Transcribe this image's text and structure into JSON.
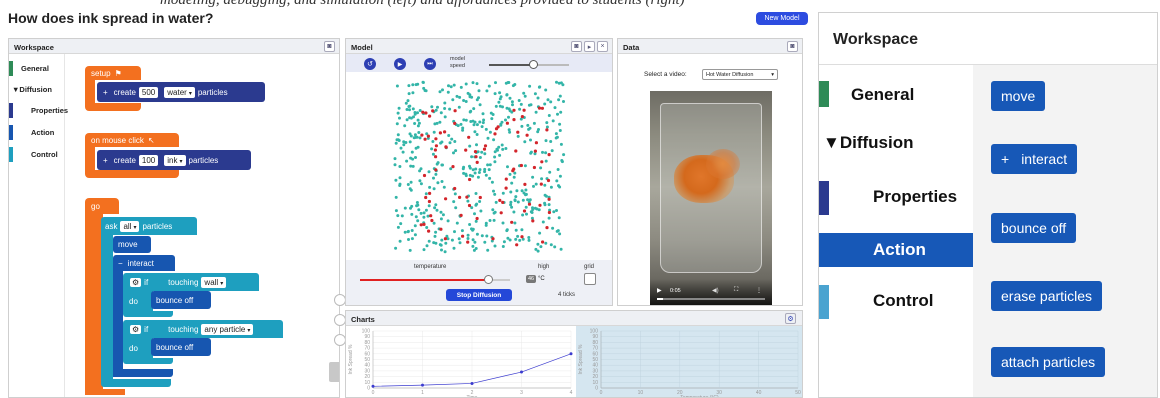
{
  "top_caption": "modeling, debugging, and simulation (left) and affordances provided to students (right)",
  "page_title": "How does ink spread in water?",
  "new_model_label": "New Model",
  "workspace": {
    "title": "Workspace",
    "categories": [
      "General",
      "▼Diffusion",
      "Properties",
      "Action",
      "Control"
    ],
    "blocks": {
      "setup": "setup",
      "create1": {
        "word": "create",
        "num": "500",
        "kind": "water",
        "suffix": "particles"
      },
      "on_mouse": "on mouse click",
      "create2": {
        "word": "create",
        "num": "100",
        "kind": "ink",
        "suffix": "particles"
      },
      "go": "go",
      "ask": {
        "word": "ask",
        "who": "all",
        "suffix": "particles"
      },
      "move": "move",
      "interact": "interact",
      "if1": {
        "if": "if",
        "touching": "touching",
        "what": "wall",
        "do": "do",
        "action": "bounce off"
      },
      "if2": {
        "if": "if",
        "touching": "touching",
        "what": "any particle",
        "do": "do",
        "action": "bounce off"
      }
    }
  },
  "model": {
    "title": "Model",
    "speed_label": "model speed",
    "temperature_label": "temperature",
    "high_label": "high",
    "grid_label": "grid",
    "temp_value": "46",
    "temp_unit": "°C",
    "temperature_level": 0.85,
    "speed_level": 0.55,
    "stop_button": "Stop Diffusion",
    "ticks": "4 ticks"
  },
  "data_panel": {
    "title": "Data",
    "select_label": "Select a video:",
    "selected": "Hot Water Diffusion",
    "time": "0:05"
  },
  "charts": {
    "title": "Charts"
  },
  "chart_data": [
    {
      "type": "line",
      "ylabel": "Ink Spread %",
      "xlabel": "Time",
      "x": [
        0,
        1,
        2,
        3,
        4
      ],
      "y": [
        3,
        5,
        8,
        28,
        60
      ],
      "xlim": [
        0,
        4
      ],
      "ylim": [
        0,
        100
      ],
      "yticks": [
        0,
        10,
        20,
        30,
        40,
        50,
        60,
        70,
        80,
        90,
        100
      ],
      "color": "#3c3ccf"
    },
    {
      "type": "scatter",
      "ylabel": "Ink Spread %",
      "xlabel": "Temperature (°C)",
      "x": [],
      "y": [],
      "xlim": [
        0,
        50
      ],
      "ylim": [
        0,
        100
      ],
      "xticks": [
        0,
        10,
        20,
        30,
        40,
        50
      ]
    }
  ],
  "right_panel": {
    "title": "Workspace",
    "categories": [
      "General",
      "▼Diffusion",
      "Properties",
      "Action",
      "Control"
    ],
    "blocks": [
      "move",
      "interact",
      "bounce off",
      "erase particles",
      "attach particles"
    ]
  }
}
